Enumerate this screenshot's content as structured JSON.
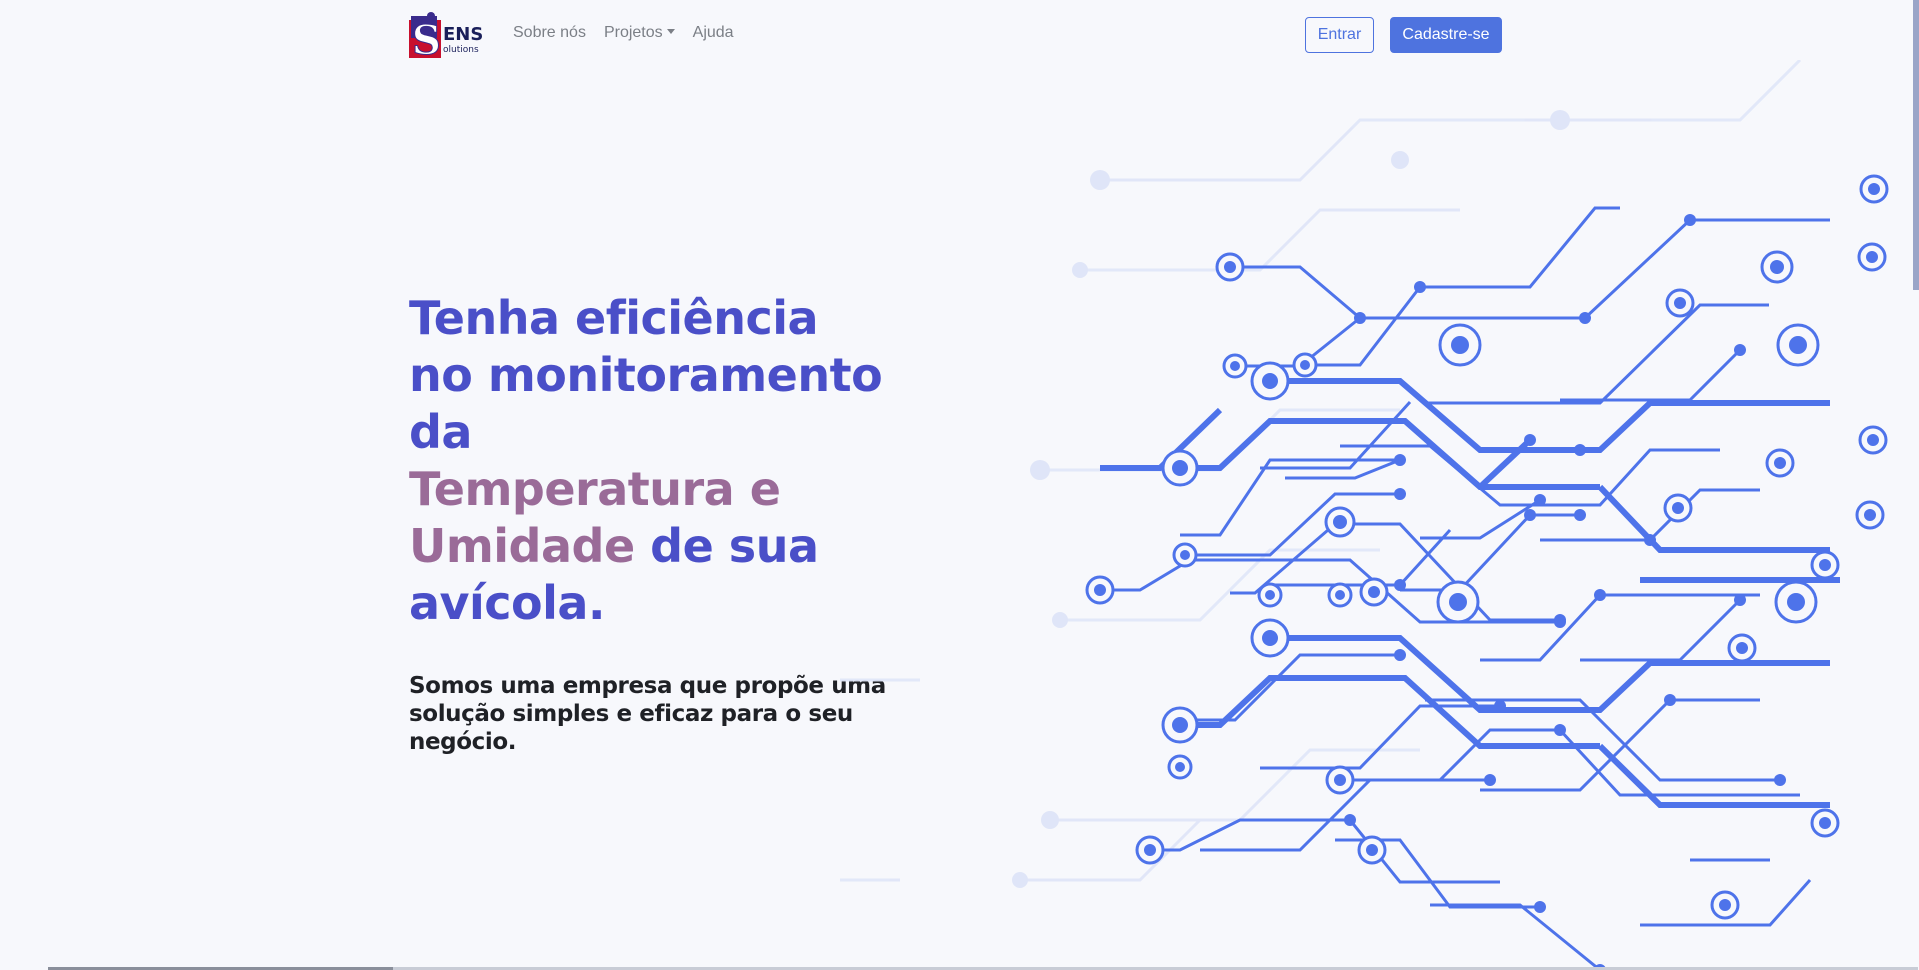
{
  "brand": {
    "logo_text": "ENS",
    "logo_sub": "olutions",
    "logo_letter": "S",
    "colors": {
      "purple": "#3a2b8c",
      "red": "#c8102e",
      "navy": "#1a1f5a"
    }
  },
  "nav": {
    "items": [
      {
        "label": "Sobre nós"
      },
      {
        "label": "Projetos",
        "has_dropdown": true
      },
      {
        "label": "Ajuda"
      }
    ],
    "login_label": "Entrar",
    "signup_label": "Cadastre-se"
  },
  "hero": {
    "title_line1": "Tenha eficiência",
    "title_line2": "no monitoramento",
    "title_line3": "da",
    "title_accent1": "Temperatura e",
    "title_accent2": "Umidade",
    "title_rest": " de sua",
    "title_line6": "avícola.",
    "subtitle": "Somos uma empresa que propõe uma solução simples e eficaz para o seu negócio."
  },
  "colors": {
    "primary": "#4e73df",
    "title": "#4a4fc8",
    "accent": "#9a6b98",
    "circuit": "#4e73ea",
    "background": "#f7f8fc"
  },
  "illustration": {
    "icon": "circuit-board-illustration"
  }
}
